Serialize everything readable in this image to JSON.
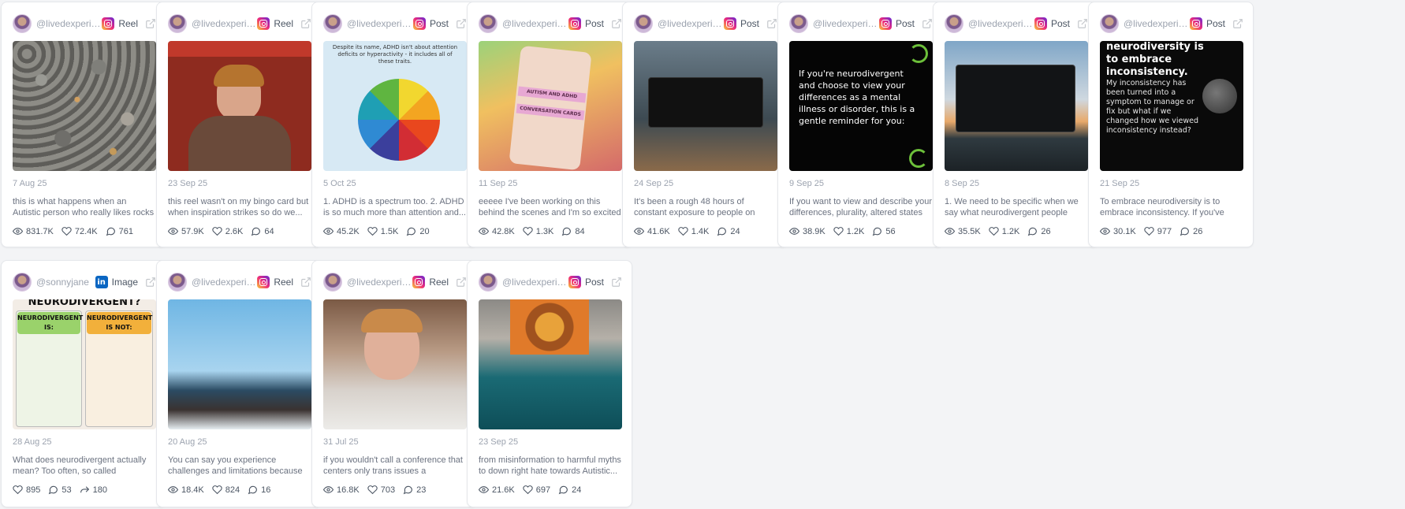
{
  "cards": [
    {
      "handle": "@livedexperie...",
      "platform": "instagram",
      "type": "Reel",
      "date": "7 Aug 25",
      "caption": "this is what happens when an Autistic person who really likes rocks visits...",
      "stats": [
        {
          "icon": "eye-icon",
          "value": "831.7K"
        },
        {
          "icon": "heart-icon",
          "value": "72.4K"
        },
        {
          "icon": "comment-icon",
          "value": "761"
        }
      ]
    },
    {
      "handle": "@livedexperie...",
      "platform": "instagram",
      "type": "Reel",
      "date": "23 Sep 25",
      "caption": "this reel wasn't on my bingo card but when inspiration strikes so do we...",
      "stats": [
        {
          "icon": "eye-icon",
          "value": "57.9K"
        },
        {
          "icon": "heart-icon",
          "value": "2.6K"
        },
        {
          "icon": "comment-icon",
          "value": "64"
        }
      ]
    },
    {
      "handle": "@livedexperie...",
      "platform": "instagram",
      "type": "Post",
      "date": "5 Oct 25",
      "caption": "1. ADHD is a spectrum too. 2. ADHD is so much more than attention and...",
      "stats": [
        {
          "icon": "eye-icon",
          "value": "45.2K"
        },
        {
          "icon": "heart-icon",
          "value": "1.5K"
        },
        {
          "icon": "comment-icon",
          "value": "20"
        }
      ]
    },
    {
      "handle": "@livedexperie...",
      "platform": "instagram",
      "type": "Post",
      "date": "11 Sep 25",
      "caption": "eeeee I've been working on this behind the scenes and I'm so excited to shar...",
      "stats": [
        {
          "icon": "eye-icon",
          "value": "42.8K"
        },
        {
          "icon": "heart-icon",
          "value": "1.3K"
        },
        {
          "icon": "comment-icon",
          "value": "84"
        }
      ]
    },
    {
      "handle": "@livedexperie...",
      "platform": "instagram",
      "type": "Post",
      "date": "24 Sep 25",
      "caption": "It's been a rough 48 hours of constant exposure to people on social media...",
      "stats": [
        {
          "icon": "eye-icon",
          "value": "41.6K"
        },
        {
          "icon": "heart-icon",
          "value": "1.4K"
        },
        {
          "icon": "comment-icon",
          "value": "24"
        }
      ]
    },
    {
      "handle": "@livedexperie...",
      "platform": "instagram",
      "type": "Post",
      "date": "9 Sep 25",
      "caption": "If you want to view and describe your differences, plurality, altered states or...",
      "stats": [
        {
          "icon": "eye-icon",
          "value": "38.9K"
        },
        {
          "icon": "heart-icon",
          "value": "1.2K"
        },
        {
          "icon": "comment-icon",
          "value": "56"
        }
      ]
    },
    {
      "handle": "@livedexperie...",
      "platform": "instagram",
      "type": "Post",
      "date": "8 Sep 25",
      "caption": "1. We need to be specific when we say what neurodivergent people are...",
      "stats": [
        {
          "icon": "eye-icon",
          "value": "35.5K"
        },
        {
          "icon": "heart-icon",
          "value": "1.2K"
        },
        {
          "icon": "comment-icon",
          "value": "26"
        }
      ]
    },
    {
      "handle": "@livedexperie...",
      "platform": "instagram",
      "type": "Post",
      "date": "21 Sep 25",
      "caption": "To embrace neurodiversity is to embrace inconsistency. If you've ever...",
      "stats": [
        {
          "icon": "eye-icon",
          "value": "30.1K"
        },
        {
          "icon": "heart-icon",
          "value": "977"
        },
        {
          "icon": "comment-icon",
          "value": "26"
        }
      ]
    },
    {
      "handle": "@sonnyjane",
      "platform": "linkedin",
      "type": "Image",
      "date": "28 Aug 25",
      "caption": "What does neurodivergent actually mean? Too often, so called experts,...",
      "stats": [
        {
          "icon": "heart-icon",
          "value": "895"
        },
        {
          "icon": "comment-icon",
          "value": "53"
        },
        {
          "icon": "share-icon",
          "value": "180"
        }
      ]
    },
    {
      "handle": "@livedexperie...",
      "platform": "instagram",
      "type": "Reel",
      "date": "20 Aug 25",
      "caption": "You can say you experience challenges and limitations because o...",
      "stats": [
        {
          "icon": "eye-icon",
          "value": "18.4K"
        },
        {
          "icon": "heart-icon",
          "value": "824"
        },
        {
          "icon": "comment-icon",
          "value": "16"
        }
      ]
    },
    {
      "handle": "@livedexperie...",
      "platform": "instagram",
      "type": "Reel",
      "date": "31 Jul 25",
      "caption": "if you wouldn't call a conference that centers only trans issues a LGBTQIA+...",
      "stats": [
        {
          "icon": "eye-icon",
          "value": "16.8K"
        },
        {
          "icon": "heart-icon",
          "value": "703"
        },
        {
          "icon": "comment-icon",
          "value": "23"
        }
      ]
    },
    {
      "handle": "@livedexperie...",
      "platform": "instagram",
      "type": "Post",
      "date": "23 Sep 25",
      "caption": "from misinformation to harmful myths to down right hate towards Autistic...",
      "stats": [
        {
          "icon": "eye-icon",
          "value": "21.6K"
        },
        {
          "icon": "heart-icon",
          "value": "697"
        },
        {
          "icon": "comment-icon",
          "value": "24"
        }
      ]
    }
  ],
  "thumb_text": {
    "t3_head": "Despite its name, ADHD isn't about attention deficits or hyperactivity - it includes all of these traits.",
    "t4_card1": "AUTISM AND ADHD",
    "t4_card2": "CONVERSATION CARDS",
    "t6_quote": "If you're neurodivergent and choose to view your differences as a mental illness or disorder, this is a gentle reminder for you:",
    "t8_head": "neurodiversity is to embrace inconsistency.",
    "t8_body": "My inconsistency has been turned into a symptom to manage or fix but what if we changed how we viewed inconsistency instead?",
    "t9_title": "NEURODIVERGENT?",
    "t9_is": "NEURODIVERGENT IS:",
    "t9_isnot": "NEURODIVERGENT IS NOT:"
  }
}
